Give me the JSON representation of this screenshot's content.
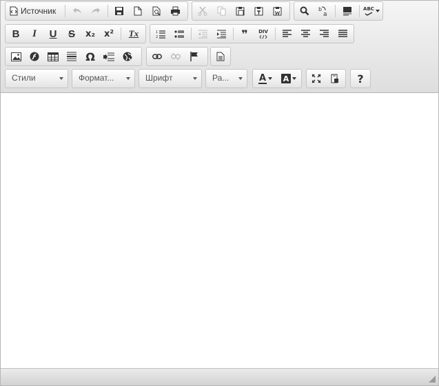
{
  "toolbar": {
    "source_label": "Источник",
    "combos": {
      "styles": "Стили",
      "format": "Формат...",
      "font": "Шрифт",
      "size": "Ра..."
    },
    "labels": {
      "bold": "B",
      "italic": "I",
      "underline": "U",
      "strike": "S",
      "subscript": "x₂",
      "superscript": "x²",
      "remove_format": "Tx",
      "blockquote": "❞",
      "div": "DIV",
      "special_char": "Ω",
      "text_color": "A",
      "bg_color": "A",
      "help": "?",
      "spellcheck": "ABC"
    }
  },
  "colors": {
    "toolbar_bg": "#dedede",
    "border": "#b6b6b6",
    "icon": "#333333",
    "disabled": "#b8b8b8"
  }
}
